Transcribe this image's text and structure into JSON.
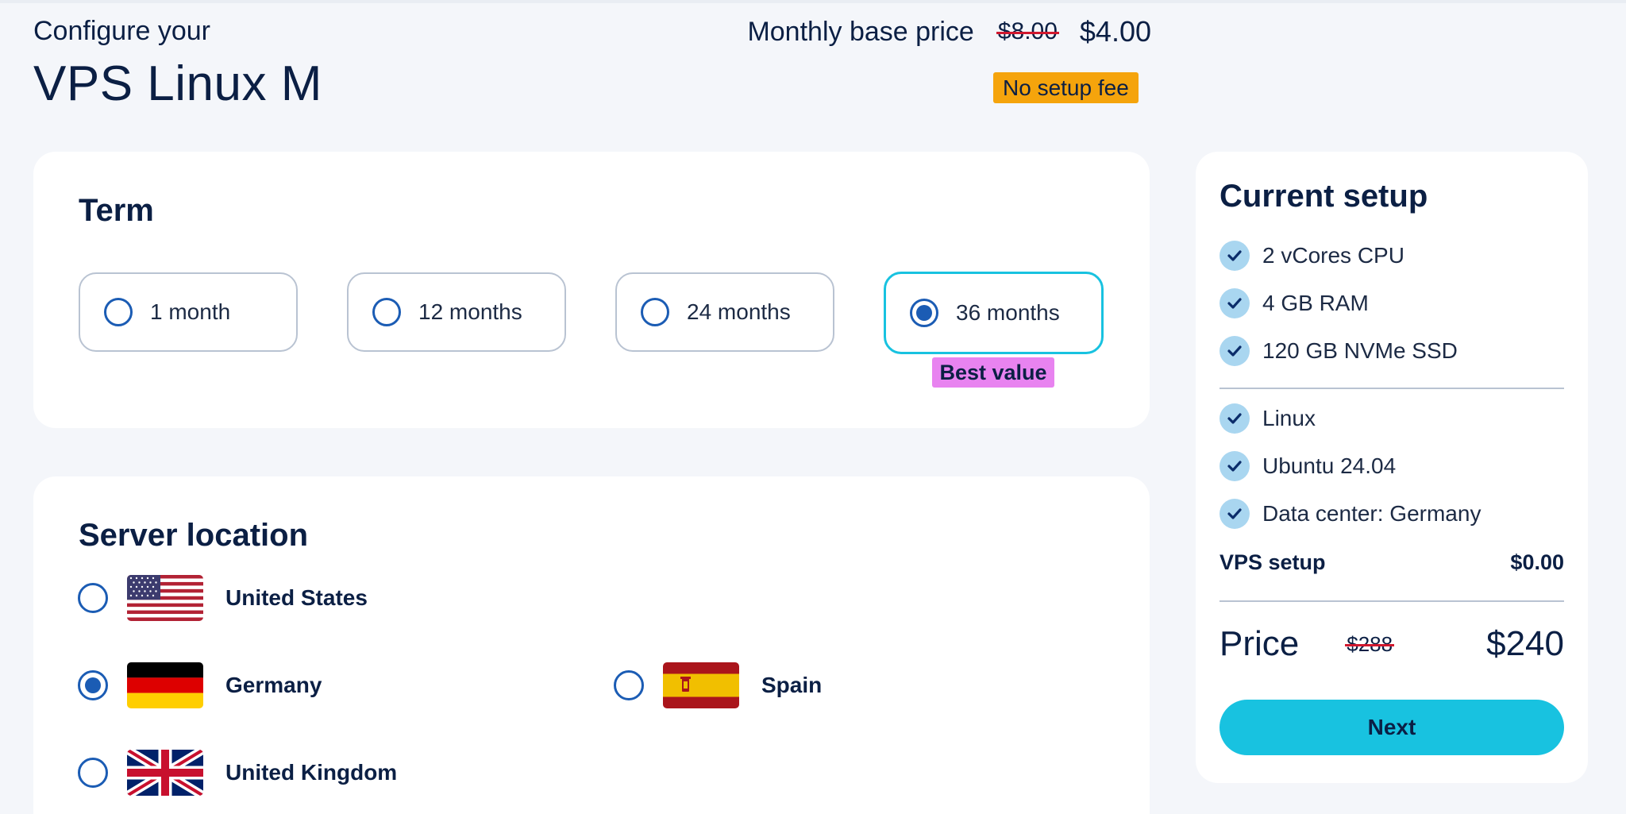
{
  "header": {
    "subtitle": "Configure your",
    "title": "VPS Linux M",
    "monthly_label": "Monthly base price",
    "old_price": "$8.00",
    "new_price": "$4.00",
    "setup_badge": "No setup fee"
  },
  "term": {
    "heading": "Term",
    "options": [
      {
        "label": "1 month",
        "selected": false
      },
      {
        "label": "12 months",
        "selected": false
      },
      {
        "label": "24 months",
        "selected": false
      },
      {
        "label": "36 months",
        "selected": true
      }
    ],
    "best_value_badge": "Best value"
  },
  "location": {
    "heading": "Server location",
    "options": [
      {
        "name": "United States",
        "flag": "us-flag-icon",
        "selected": false
      },
      {
        "name": "Germany",
        "flag": "de-flag-icon",
        "selected": true
      },
      {
        "name": "Spain",
        "flag": "es-flag-icon",
        "selected": false
      },
      {
        "name": "United Kingdom",
        "flag": "uk-flag-icon",
        "selected": false
      }
    ]
  },
  "setup": {
    "heading": "Current setup",
    "items": [
      "2 vCores CPU",
      "4 GB RAM",
      "120 GB NVMe SSD",
      "Linux",
      "Ubuntu 24.04",
      "Data center: Germany"
    ],
    "vps_setup_label": "VPS setup",
    "vps_setup_value": "$0.00",
    "price_label": "Price",
    "price_old": "$288",
    "price_new": "$240",
    "next_label": "Next"
  },
  "colors": {
    "accent": "#18c2e0",
    "radio": "#1b5cb4",
    "badge_orange": "#f5a40c",
    "badge_pink": "#e883f0",
    "strike_red": "#d0182e"
  }
}
